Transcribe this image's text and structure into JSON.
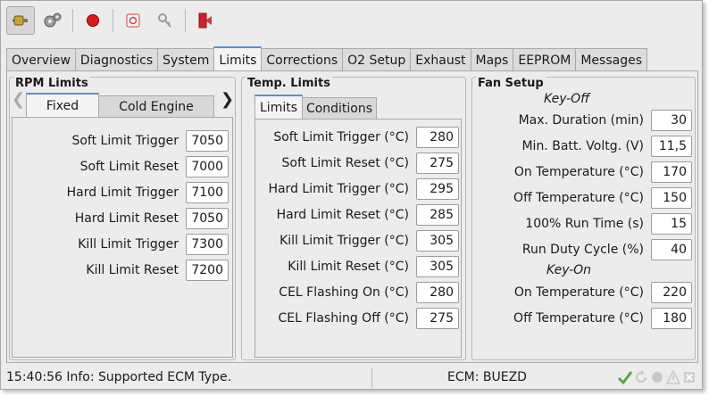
{
  "toolbar": {
    "buttons": [
      "connect-icon",
      "settings-gears-icon",
      "record-icon",
      "ecm-chip-icon",
      "key-icon",
      "exit-icon"
    ]
  },
  "tabs": [
    "Overview",
    "Diagnostics",
    "System",
    "Limits",
    "Corrections",
    "O2 Setup",
    "Exhaust",
    "Maps",
    "EEPROM",
    "Messages"
  ],
  "active_tab": "Limits",
  "rpm_limits": {
    "title": "RPM Limits",
    "subtabs": [
      "Fixed",
      "Cold Engine"
    ],
    "rows": [
      {
        "label": "Soft Limit Trigger",
        "value": "7050"
      },
      {
        "label": "Soft Limit Reset",
        "value": "7000"
      },
      {
        "label": "Hard Limit Trigger",
        "value": "7100"
      },
      {
        "label": "Hard Limit Reset",
        "value": "7050"
      },
      {
        "label": "Kill Limit Trigger",
        "value": "7300"
      },
      {
        "label": "Kill Limit Reset",
        "value": "7200"
      }
    ]
  },
  "temp_limits": {
    "title": "Temp. Limits",
    "subtabs": [
      "Limits",
      "Conditions"
    ],
    "rows": [
      {
        "label": "Soft Limit Trigger (°C)",
        "value": "280"
      },
      {
        "label": "Soft Limit Reset (°C)",
        "value": "275"
      },
      {
        "label": "Hard Limit Trigger (°C)",
        "value": "295"
      },
      {
        "label": "Hard Limit Reset (°C)",
        "value": "285"
      },
      {
        "label": "Kill Limit Trigger (°C)",
        "value": "305"
      },
      {
        "label": "Kill Limit Reset (°C)",
        "value": "305"
      },
      {
        "label": "CEL Flashing On (°C)",
        "value": "280"
      },
      {
        "label": "CEL Flashing Off (°C)",
        "value": "275"
      }
    ]
  },
  "fan_setup": {
    "title": "Fan Setup",
    "key_off_label": "Key-Off",
    "key_off_rows": [
      {
        "label": "Max. Duration (min)",
        "value": "30"
      },
      {
        "label": "Min.  Batt. Voltg. (V)",
        "value": "11,5"
      },
      {
        "label": "On Temperature (°C)",
        "value": "170"
      },
      {
        "label": "Off Temperature (°C)",
        "value": "150"
      },
      {
        "label": "100% Run Time (s)",
        "value": "15"
      },
      {
        "label": "Run Duty Cycle (%)",
        "value": "40"
      }
    ],
    "key_on_label": "Key-On",
    "key_on_rows": [
      {
        "label": "On Temperature (°C)",
        "value": "220"
      },
      {
        "label": "Off Temperature (°C)",
        "value": "180"
      }
    ]
  },
  "status": {
    "message": "15:40:56 Info: Supported ECM Type.",
    "ecm": "ECM: BUEZD",
    "icons": [
      "checkmark-icon",
      "refresh-icon",
      "circle-icon",
      "warning-icon",
      "error-icon"
    ]
  }
}
